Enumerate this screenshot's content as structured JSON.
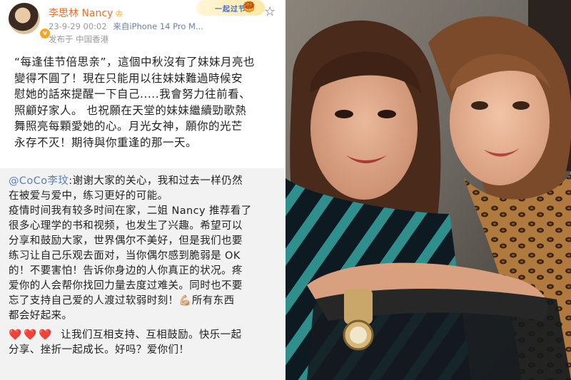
{
  "post": {
    "username": "李思林 Nancy",
    "crown_icon": "crown-icon",
    "timestamp": "23-9-29 00:02",
    "source": "来自iPhone 14 Pro M...",
    "location": "发布于 中国香港",
    "badge_text": "一起过节",
    "star_icon": "star-outline-icon",
    "quote_lines": [
      "“每逢佳节倍思亲”，這個中秋沒有了妹妹月亮也",
      "變得不圓了！現在只能用以往妹妹難過時候安",
      "慰她的話來提醒一下自己.....我會努力往前看、",
      "照顧好家人。 也祝願在天堂的妹妹繼續勁歌熱",
      "舞照亮每顆愛她的心。月光女神，願你的光芒",
      "永存不灭！期待與你重逢的那一天。"
    ]
  },
  "comment": {
    "mention": "@CoCo李玟",
    "line1_rest": ":谢谢大家的关心，我和过去一样仍然",
    "lines": [
      "在被爱与爱中，练习更好的可能。",
      "疫情时间我有较多时间在家，二姐 Nancy 推荐看了",
      "很多心理学的书和视频，也发生了兴趣。希望可以",
      "分享和鼓励大家，世界偶尔不美好，但是我们也要",
      "练习让自己乐观去面对，当你偶尔感到脆弱是 OK",
      "的！不要害怕！告诉你身边的人你真正的状况。疼",
      "爱你的人会帮你找回力量去度过难关。同时也不要",
      "忘了支持自己爱的人渡过软弱时刻！"
    ],
    "muscle_emoji": "💪🏼",
    "line_after_muscle": "所有东西",
    "line9": "都会好起来。",
    "hearts": "❤️❤️❤️",
    "line10_rest": "让我们互相支持、互相鼓励。快乐一起",
    "line11": "分享、挫折一起成长。好吗？爱你们！"
  },
  "colors": {
    "username": "#ea6f2a",
    "mention": "#5b7fb8",
    "comment_bg": "#f2f2f2",
    "heart": "#e0332a"
  }
}
